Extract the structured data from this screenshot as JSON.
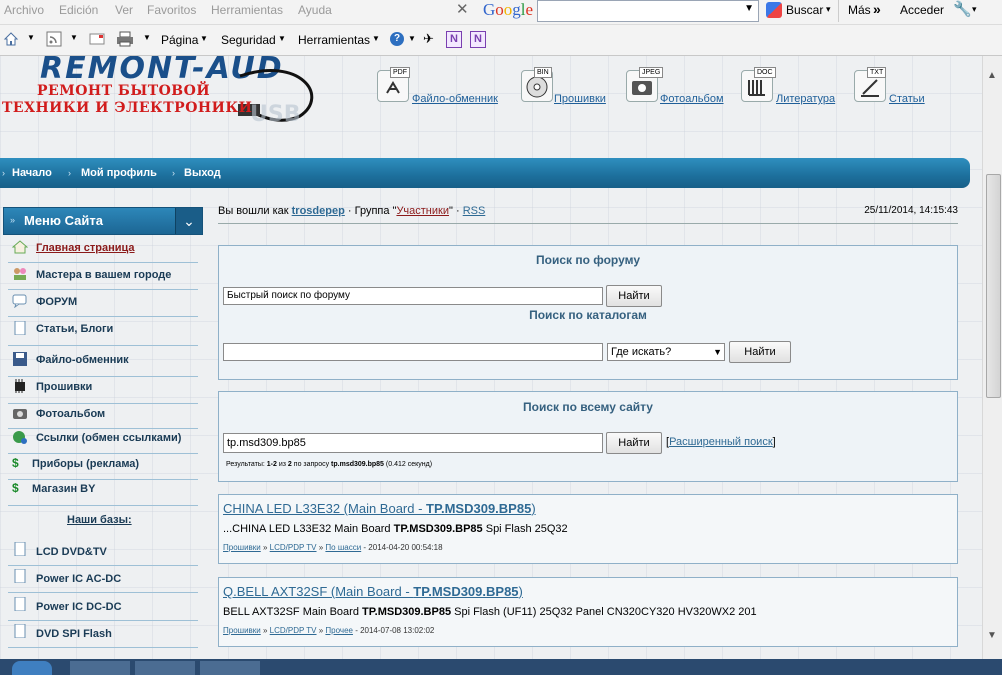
{
  "browser": {
    "menu": [
      "Archivo",
      "Edición",
      "Ver",
      "Favoritos",
      "Herramientas",
      "Ayuda"
    ],
    "google_brand": "Google",
    "search_button": "Buscar",
    "more_label": "Más",
    "signin_label": "Acceder",
    "commands": [
      "Página",
      "Seguridad",
      "Herramientas"
    ]
  },
  "site": {
    "logo_line1": "РЕМОНТ БЫТОВОЙ",
    "logo_line2": "ТЕХНИКИ И ЭЛЕКТРОНИКИ",
    "top_nav": [
      {
        "label": "Файло-обменник",
        "tag": "PDF",
        "icon": "pdf-file-icon"
      },
      {
        "label": "Прошивки",
        "tag": "BIN",
        "icon": "disc-icon"
      },
      {
        "label": "Фотоальбом",
        "tag": "JPEG",
        "icon": "camera-icon"
      },
      {
        "label": "Литература",
        "tag": "DOC",
        "icon": "book-icon"
      },
      {
        "label": "Статьи",
        "tag": "TXT",
        "icon": "pen-icon"
      }
    ],
    "bluebar": [
      "Начало",
      "Мой профиль",
      "Выход"
    ]
  },
  "sidebar": {
    "title": "Меню Сайта",
    "items": [
      {
        "label": "Главная страница",
        "icon": "home-icon"
      },
      {
        "label": "Мастера в вашем городе",
        "icon": "people-icon"
      },
      {
        "label": "ФОРУМ",
        "icon": "chat-icon"
      },
      {
        "label": "Статьи, Блоги",
        "icon": "document-icon"
      },
      {
        "label": "Файло-обменник",
        "icon": "floppy-icon"
      },
      {
        "label": "Прошивки",
        "icon": "chip-icon"
      },
      {
        "label": "Фотоальбом",
        "icon": "camera-icon"
      },
      {
        "label": "Ссылки (обмен ссылками)",
        "icon": "globe-icon"
      },
      {
        "label": "Приборы (реклама)",
        "icon": "dollar-icon"
      },
      {
        "label": "Магазин BY",
        "icon": "dollar-icon"
      }
    ],
    "bases_title": "Наши базы:",
    "bases": [
      "LCD DVD&TV",
      "Power IC AC-DC",
      "Power IC DC-DC",
      "DVD SPI Flash"
    ]
  },
  "user": {
    "prefix": "Вы вошли как",
    "name": "trosdepep",
    "group_label": "· Группа \"",
    "group": "Участники",
    "group_end": "\" ·",
    "rss": "RSS",
    "datetime": "25/11/2014, 14:15:43"
  },
  "forum_search": {
    "title": "Поиск по форуму",
    "value": "Быстрый поиск по форуму",
    "button": "Найти"
  },
  "catalog_search": {
    "title": "Поиск по каталогам",
    "value": "",
    "select": "Где искать?",
    "button": "Найти"
  },
  "site_search": {
    "title": "Поиск по всему сайту",
    "value": "tp.msd309.bp85",
    "button": "Найти",
    "advanced": "Расширенный поиск",
    "summary_prefix": "Результаты:",
    "summary_range": "1-2",
    "summary_mid": "из",
    "summary_total": "2",
    "summary_query_label": "по запросу",
    "summary_query": "tp.msd309.bp85",
    "summary_time": "(0.412 секунд)"
  },
  "results": [
    {
      "title_plain": "CHINA LED L33E32 (Main Board - ",
      "title_bold": "TP.MSD309.BP85",
      "title_end": ")",
      "body_pre": "...CHINA LED L33E32 Main Board ",
      "body_bold": "TP.MSD309.BP85",
      "body_post": " Spi Flash 25Q32",
      "crumbs": [
        "Прошивки",
        "LCD/PDP TV",
        "По шасси"
      ],
      "date": " - 2014-04-20 00:54:18"
    },
    {
      "title_plain": "Q.BELL AXT32SF (Main Board - ",
      "title_bold": "TP.MSD309.BP85",
      "title_end": ")",
      "body_pre": "BELL AXT32SF Main Board ",
      "body_bold": "TP.MSD309.BP85",
      "body_post": " Spi Flash (UF11) 25Q32 Panel CN320CY320 HV320WX2 201",
      "crumbs": [
        "Прошивки",
        "LCD/PDP TV",
        "Прочее"
      ],
      "date": " - 2014-07-08 13:02:02"
    }
  ]
}
